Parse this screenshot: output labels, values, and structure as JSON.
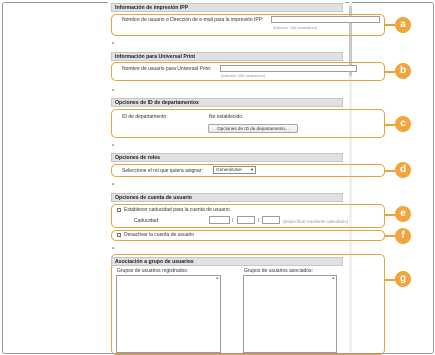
{
  "ipp": {
    "header": "Información de impresión IPP",
    "username_label": "Nombre de usuario o Dirección de e-mail para la impresión IPP:",
    "username_value": "",
    "username_hint": "(Máximo 256 caracteres)"
  },
  "universal_print": {
    "header": "Información para Universal Print",
    "username_label": "Nombre de usuario para Universal Print:",
    "username_value": "",
    "username_hint": "(Máximo 256 caracteres)"
  },
  "department": {
    "header": "Opciones de ID de departamentos",
    "id_label": "ID de departamento:",
    "id_value": "No establecido.",
    "options_button": "Opciones de ID de departamento..."
  },
  "roles": {
    "header": "Opciones de roles",
    "role_label": "Seleccione el rol que quiera asignar:",
    "role_value": "GeneralUser"
  },
  "account": {
    "header": "Opciones de cuenta de usuario",
    "expiry_checkbox_label": "Establecer caducidad para la cuenta de usuario",
    "expiry_label": "Caducidad:",
    "date_sep1": "/",
    "date_sep2": "/",
    "date_hint": "(Especificar mediante calendario)",
    "disable_checkbox_label": "Desactivar la cuenta de usuario"
  },
  "groups": {
    "header": "Asociación a grupo de usuarios",
    "registered_label": "Grupos de usuarios registrados:",
    "associated_label": "Grupos de usuarios asociados:"
  },
  "callouts": [
    "a",
    "b",
    "c",
    "d",
    "e",
    "f",
    "g"
  ],
  "separator_glyph": "⌅",
  "colors": {
    "callout": "#f0a63d",
    "header_bg": "#e1e1e1"
  }
}
